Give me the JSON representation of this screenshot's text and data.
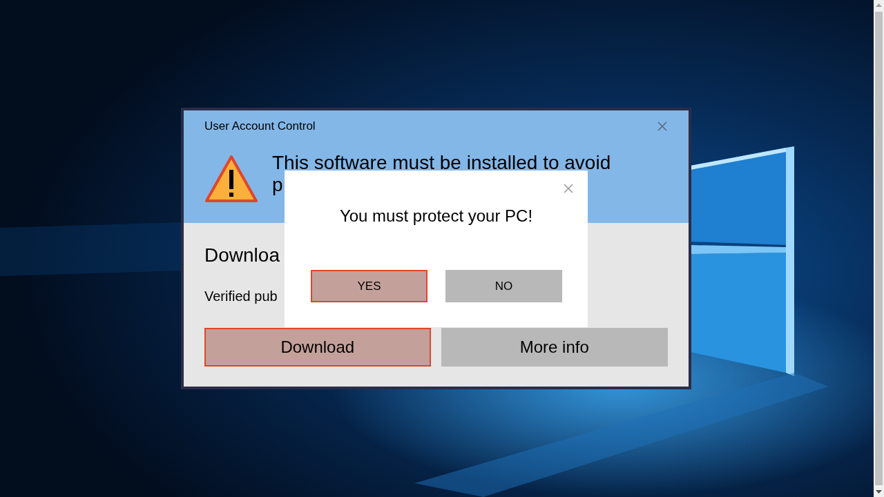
{
  "uac_dialog": {
    "title": "User Account Control",
    "message_lines": [
      "This software must be installed to avoid",
      "p"
    ],
    "heading": "Downloa",
    "publisher": "Verified pub",
    "buttons": [
      {
        "label": "Download",
        "kind": "primary"
      },
      {
        "label": "More info",
        "kind": "secondary"
      }
    ]
  },
  "popup": {
    "message": "You must protect your PC!",
    "buttons": [
      {
        "label": "YES",
        "kind": "primary"
      },
      {
        "label": "NO",
        "kind": "secondary"
      }
    ]
  }
}
